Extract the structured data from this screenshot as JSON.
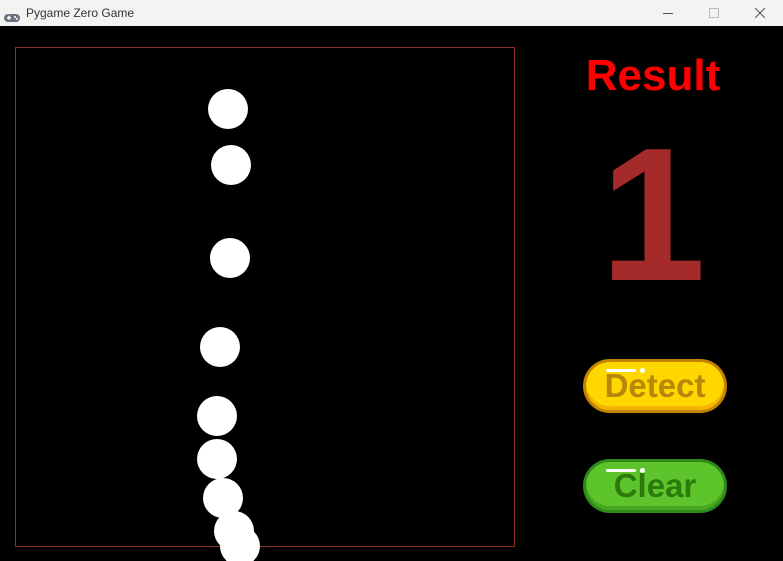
{
  "window": {
    "title": "Pygame Zero Game",
    "controls": {
      "minimize": "—",
      "maximize": "☐",
      "close": "✕"
    }
  },
  "canvas": {
    "frame_color": "#8b2f25",
    "stroke_color": "#ffffff",
    "background": "#000000",
    "dot_count": 9
  },
  "result": {
    "label": "Result",
    "value": "1",
    "label_color": "#ff0000",
    "value_color": "#a52a2a"
  },
  "buttons": {
    "detect": {
      "label": "Detect",
      "color": "#ffd700"
    },
    "clear": {
      "label": "Clear",
      "color": "#5dc52b"
    }
  }
}
